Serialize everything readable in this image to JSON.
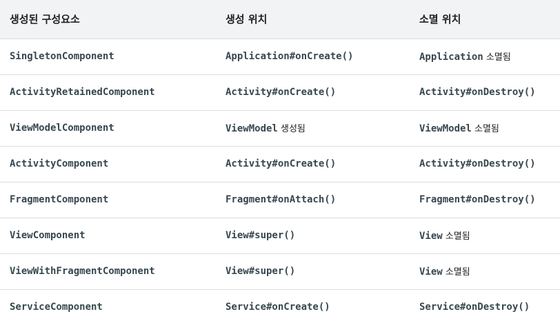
{
  "headers": [
    "생성된 구성요소",
    "생성 위치",
    "소멸 위치"
  ],
  "rows": [
    {
      "component": "SingletonComponent",
      "created": {
        "code": "Application#onCreate()",
        "text": ""
      },
      "destroyed": {
        "code": "Application",
        "text": " 소멸됨"
      }
    },
    {
      "component": "ActivityRetainedComponent",
      "created": {
        "code": "Activity#onCreate()",
        "text": ""
      },
      "destroyed": {
        "code": "Activity#onDestroy()",
        "text": ""
      }
    },
    {
      "component": "ViewModelComponent",
      "created": {
        "code": "ViewModel",
        "text": " 생성됨"
      },
      "destroyed": {
        "code": "ViewModel",
        "text": " 소멸됨"
      }
    },
    {
      "component": "ActivityComponent",
      "created": {
        "code": "Activity#onCreate()",
        "text": ""
      },
      "destroyed": {
        "code": "Activity#onDestroy()",
        "text": ""
      }
    },
    {
      "component": "FragmentComponent",
      "created": {
        "code": "Fragment#onAttach()",
        "text": ""
      },
      "destroyed": {
        "code": "Fragment#onDestroy()",
        "text": ""
      }
    },
    {
      "component": "ViewComponent",
      "created": {
        "code": "View#super()",
        "text": ""
      },
      "destroyed": {
        "code": "View",
        "text": " 소멸됨"
      }
    },
    {
      "component": "ViewWithFragmentComponent",
      "created": {
        "code": "View#super()",
        "text": ""
      },
      "destroyed": {
        "code": "View",
        "text": " 소멸됨"
      }
    },
    {
      "component": "ServiceComponent",
      "created": {
        "code": "Service#onCreate()",
        "text": ""
      },
      "destroyed": {
        "code": "Service#onDestroy()",
        "text": ""
      }
    }
  ]
}
